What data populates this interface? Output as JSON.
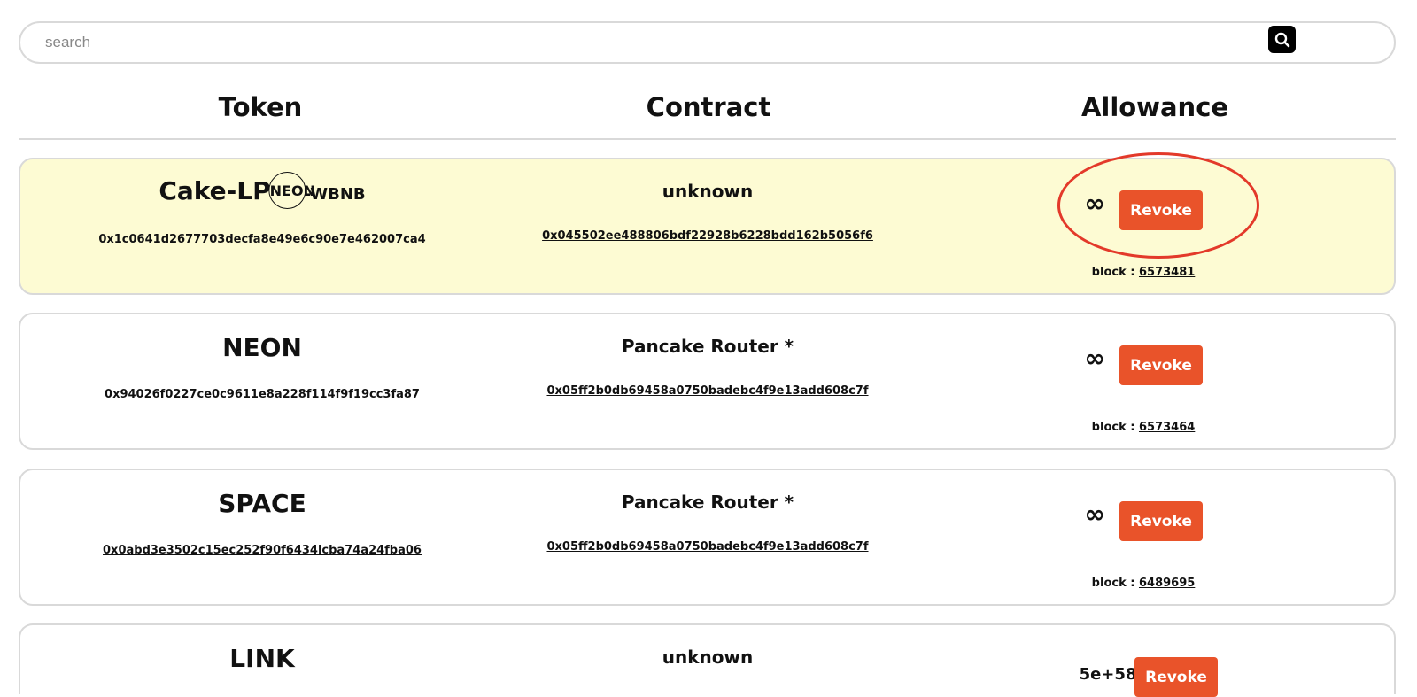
{
  "search": {
    "placeholder": "search",
    "value": ""
  },
  "header": {
    "token": "Token",
    "contract": "Contract",
    "allowance": "Allowance"
  },
  "colors": {
    "revoke": "#e9532a",
    "highlight_row": "#fdfbd3",
    "annotation_circle": "#e3392a"
  },
  "rows": [
    {
      "token_prefix": "Cake-LP",
      "token_icon_text": "NEON",
      "token_suffix": "-WBNB",
      "token_address": "0x1c0641d2677703decfa8e49e6c90e7e462007ca4",
      "contract_name": "unknown",
      "contract_address": "0x045502ee488806bdf22928b6228bdd162b5056f6",
      "allowance": "∞",
      "revoke_label": "Revoke",
      "block_label": "block :",
      "block_number": "6573481"
    },
    {
      "token_name": "NEON",
      "token_address": "0x94026f0227ce0c9611e8a228f114f9f19cc3fa87",
      "contract_name": "Pancake Router *",
      "contract_address": "0x05ff2b0db69458a0750badebc4f9e13add608c7f",
      "allowance": "∞",
      "revoke_label": "Revoke",
      "block_label": "block :",
      "block_number": "6573464"
    },
    {
      "token_name": "SPACE",
      "token_address": "0x0abd3e3502c15ec252f90f6434lcba74a24fba06",
      "contract_name": "Pancake Router *",
      "contract_address": "0x05ff2b0db69458a0750badebc4f9e13add608c7f",
      "allowance": "∞",
      "revoke_label": "Revoke",
      "block_label": "block :",
      "block_number": "6489695"
    },
    {
      "token_name": "LINK",
      "contract_name": "unknown",
      "allowance": "5e+58",
      "revoke_label": "Revoke"
    }
  ]
}
